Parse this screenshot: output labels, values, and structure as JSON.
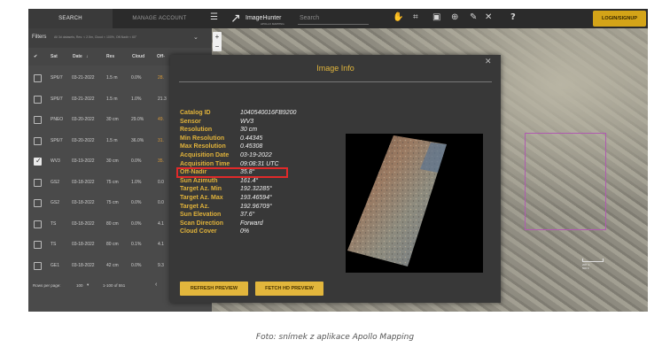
{
  "header": {
    "tabs": [
      "SEARCH",
      "MANAGE ACCOUNT"
    ],
    "app_name": "ImageHunter",
    "app_sub": "APOLLO MAPPING",
    "search_placeholder": "Search",
    "login_label": "LOGIN/SIGNUP"
  },
  "filters": {
    "title": "Filters",
    "summary": "All 3d datasets, Res: < 2.5m, Cloud < 100%, Off-Nadir < 60°"
  },
  "table": {
    "headers": [
      "Sat",
      "Date",
      "Res",
      "Cloud",
      "Off-"
    ],
    "rows": [
      {
        "checked": false,
        "sat": "SP6/7",
        "date": "03-21-2022",
        "res": "1.5 m",
        "cloud": "0.0%",
        "off": "28.",
        "off_warn": true
      },
      {
        "checked": false,
        "sat": "SP6/7",
        "date": "03-21-2022",
        "res": "1.5 m",
        "cloud": "1.0%",
        "off": "21.3",
        "off_warn": false
      },
      {
        "checked": false,
        "sat": "PNEO",
        "date": "03-20-2022",
        "res": "30 cm",
        "cloud": "29.0%",
        "off": "49.",
        "off_warn": true
      },
      {
        "checked": false,
        "sat": "SP6/7",
        "date": "03-20-2022",
        "res": "1.5 m",
        "cloud": "36.0%",
        "off": "31.",
        "off_warn": true
      },
      {
        "checked": true,
        "sat": "WV3",
        "date": "03-19-2022",
        "res": "30 cm",
        "cloud": "0.0%",
        "off": "35.",
        "off_warn": true
      },
      {
        "checked": false,
        "sat": "GS2",
        "date": "03-18-2022",
        "res": "75 cm",
        "cloud": "1.0%",
        "off": "0.0",
        "off_warn": false
      },
      {
        "checked": false,
        "sat": "GS2",
        "date": "03-18-2022",
        "res": "75 cm",
        "cloud": "0.0%",
        "off": "0.0",
        "off_warn": false
      },
      {
        "checked": false,
        "sat": "TS",
        "date": "03-18-2022",
        "res": "80 cm",
        "cloud": "0.0%",
        "off": "4.1",
        "off_warn": false
      },
      {
        "checked": false,
        "sat": "TS",
        "date": "03-18-2022",
        "res": "80 cm",
        "cloud": "0.1%",
        "off": "4.1",
        "off_warn": false
      },
      {
        "checked": false,
        "sat": "GE1",
        "date": "03-18-2022",
        "res": "42 cm",
        "cloud": "0.0%",
        "off": "9.3",
        "off_warn": false
      }
    ],
    "footer": {
      "rows_per_page_label": "Rows per page:",
      "rows_per_page": "100",
      "range": "1-100 of 551"
    }
  },
  "map": {
    "zoom_in": "+",
    "zoom_out": "−",
    "scale_labels": [
      "200 m",
      "500 ft"
    ]
  },
  "modal": {
    "title": "Image Info",
    "fields": [
      {
        "label": "Catalog ID",
        "value": "1040540016FB9200"
      },
      {
        "label": "Sensor",
        "value": "WV3"
      },
      {
        "label": "Resolution",
        "value": "30 cm"
      },
      {
        "label": "Min Resolution",
        "value": "0.44345"
      },
      {
        "label": "Max Resolution",
        "value": "0.45308"
      },
      {
        "label": "Acquisition Date",
        "value": "03-19-2022"
      },
      {
        "label": "Acquisition Time",
        "value": "09:08:31 UTC"
      },
      {
        "label": "Off-Nadir",
        "value": "35.8°"
      },
      {
        "label": "Sun Azimuth",
        "value": "161.4°"
      },
      {
        "label": "Target Az. Min",
        "value": "192.32285°"
      },
      {
        "label": "Target Az. Max",
        "value": "193.46594°"
      },
      {
        "label": "Target Az.",
        "value": "192.96709°"
      },
      {
        "label": "Sun Elevation",
        "value": "37.6°"
      },
      {
        "label": "Scan Direction",
        "value": "Forward"
      },
      {
        "label": "Cloud Cover",
        "value": "0%"
      }
    ],
    "highlighted_field": "Acquisition Time",
    "refresh_label": "REFRESH PREVIEW",
    "fetch_label": "FETCH HD PREVIEW"
  },
  "caption": "Foto: snímek z aplikace Apollo Mapping",
  "colors": {
    "accent": "#e2b63c",
    "highlight": "#e02a2a",
    "aoi": "#b05ab0"
  }
}
